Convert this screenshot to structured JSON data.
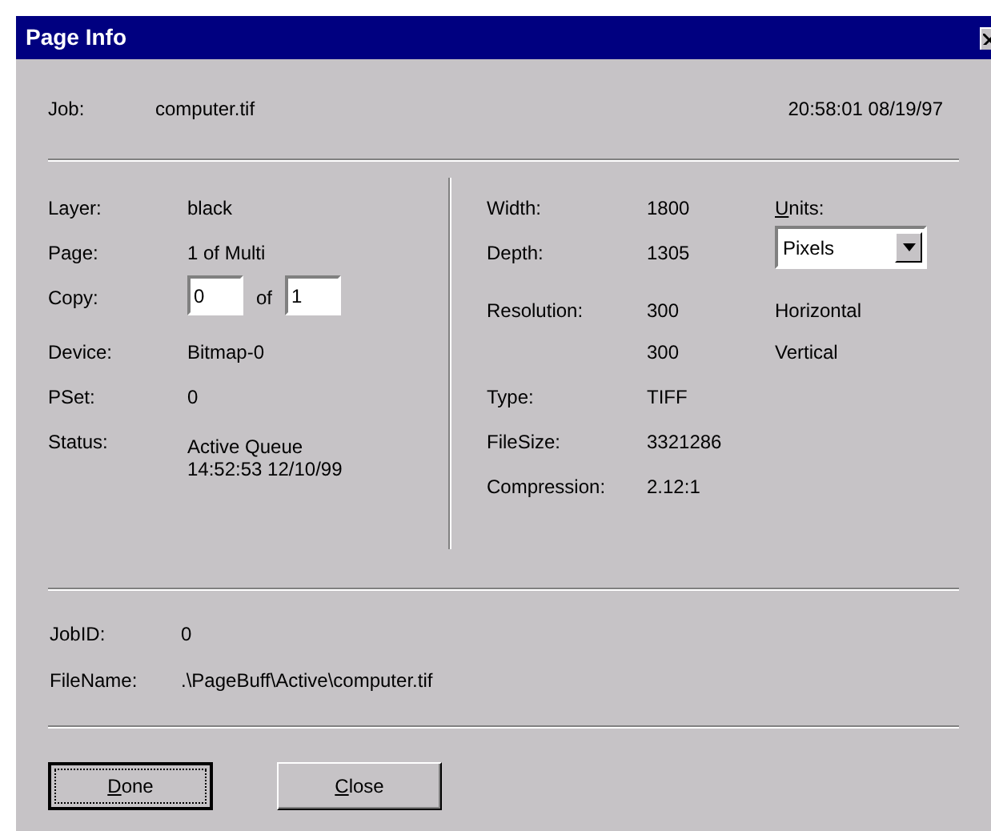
{
  "window": {
    "title": "Page Info"
  },
  "job": {
    "label": "Job:",
    "value": "computer.tif",
    "timestamp": "20:58:01 08/19/97"
  },
  "left": [
    {
      "kind": "text",
      "label": "Layer:",
      "value": "black"
    },
    {
      "kind": "text",
      "label": "Page:",
      "value": "1 of Multi"
    },
    {
      "kind": "copy",
      "label": "Copy:",
      "field": "0",
      "of": "of",
      "total": "1"
    },
    {
      "kind": "text",
      "label": "Device:",
      "value": "Bitmap-0"
    },
    {
      "kind": "text",
      "label": "PSet:",
      "value": "0"
    },
    {
      "kind": "multiline",
      "label": "Status:",
      "lines": [
        "Active Queue",
        "14:52:53 12/10/99"
      ]
    }
  ],
  "right": [
    {
      "label": "Width:",
      "value": "1800"
    },
    {
      "label": "Depth:",
      "value": "1305"
    },
    {
      "label": "Resolution:",
      "value": "300",
      "note": "Horizontal"
    },
    {
      "value": "300",
      "note": "Vertical"
    },
    {
      "label": "Type:",
      "value": "TIFF"
    },
    {
      "label": "FileSize:",
      "value": "3321286"
    },
    {
      "label": "Compression:",
      "value": "2.12:1"
    }
  ],
  "units": {
    "label": "Units:",
    "mnemonic": true,
    "value": "Pixels"
  },
  "bottom": [
    {
      "label": "JobID:",
      "value": "0"
    },
    {
      "label": "FileName:",
      "value": ".\\PageBuff\\Active\\computer.tif"
    }
  ],
  "buttons": [
    {
      "label": "Done",
      "default": true,
      "mnemonic": true
    },
    {
      "label": "Close",
      "default": false,
      "mnemonic": true
    }
  ]
}
